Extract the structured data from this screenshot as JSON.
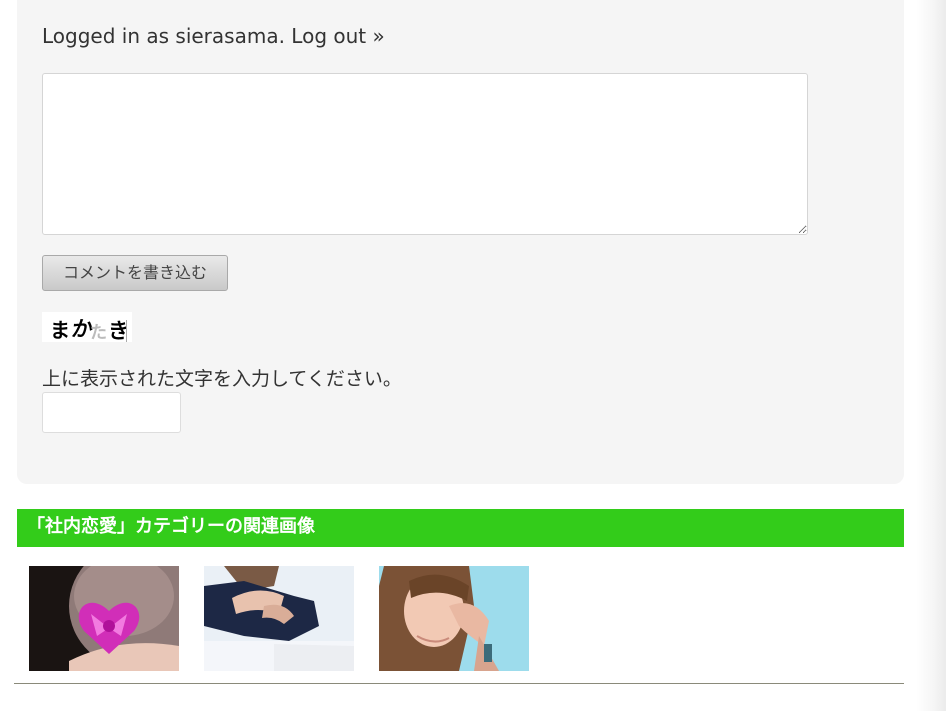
{
  "comment_form": {
    "logged_in_prefix": "Logged in as sierasama.",
    "logout_label": "Log out »",
    "textarea_value": "",
    "submit_label": "コメントを書き込む",
    "captcha_chars": [
      "ま",
      "か",
      "た",
      "き"
    ],
    "captcha_prompt": "上に表示された文字を入力してください。",
    "captcha_input_value": ""
  },
  "related": {
    "header": "「社内恋愛」カテゴリーの関連画像",
    "thumbnails": [
      {
        "icon": "ribbon-heart-photo"
      },
      {
        "icon": "woman-navy-top-photo"
      },
      {
        "icon": "woman-crying-photo"
      }
    ]
  },
  "colors": {
    "accent_green": "#33cc1a",
    "form_background": "#f5f5f5"
  }
}
